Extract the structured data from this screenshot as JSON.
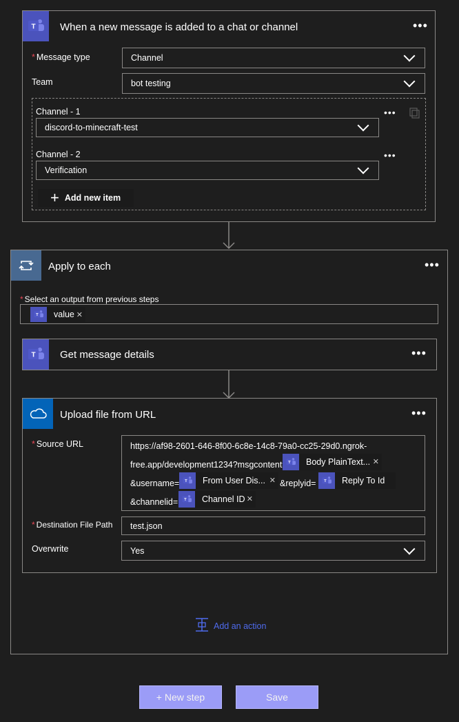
{
  "trigger": {
    "title": "When a new message is added to a chat or channel",
    "message_type_label": "Message type",
    "message_type_value": "Channel",
    "team_label": "Team",
    "team_value": "bot testing",
    "channel1_label": "Channel - 1",
    "channel1_value": "discord-to-minecraft-test",
    "channel2_label": "Channel - 2",
    "channel2_value": "Verification",
    "add_item_label": "Add new item"
  },
  "apply_each": {
    "title": "Apply to each",
    "output_label": "Select an output from previous steps",
    "output_token": "value",
    "get_details": {
      "title": "Get message details"
    },
    "upload": {
      "title": "Upload file from URL",
      "source_label": "Source URL",
      "url_line1": "https://af98-2601-646-8f00-6c8e-14c8-79a0-cc25-29d0.ngrok-",
      "url_line2": "free.app/development1234?msgcontent=",
      "token_body": "Body PlainText...",
      "url_username": "&username=",
      "token_user": "From User Dis...",
      "url_replyid": "&replyid=",
      "token_reply": "Reply To Id",
      "url_channelid": "&channelid=",
      "token_channel": "Channel ID",
      "dest_label": "Destination File Path",
      "dest_value": "test.json",
      "overwrite_label": "Overwrite",
      "overwrite_value": "Yes"
    },
    "add_action": "Add an action"
  },
  "footer": {
    "new_step": "+ New step",
    "save": "Save"
  },
  "colors": {
    "background": "#1e1e1e",
    "teams": "#4b53bc",
    "onedrive": "#0364b8",
    "loop": "#486991",
    "accent_link": "#4f6bed",
    "button": "#9b9cf7",
    "required": "#e74856"
  },
  "icons": [
    "teams-icon",
    "loop-icon",
    "onedrive-icon",
    "chevron-down-icon",
    "more-icon",
    "plus-icon",
    "copy-icon",
    "arrow-down-icon",
    "insert-action-icon",
    "close-icon"
  ]
}
